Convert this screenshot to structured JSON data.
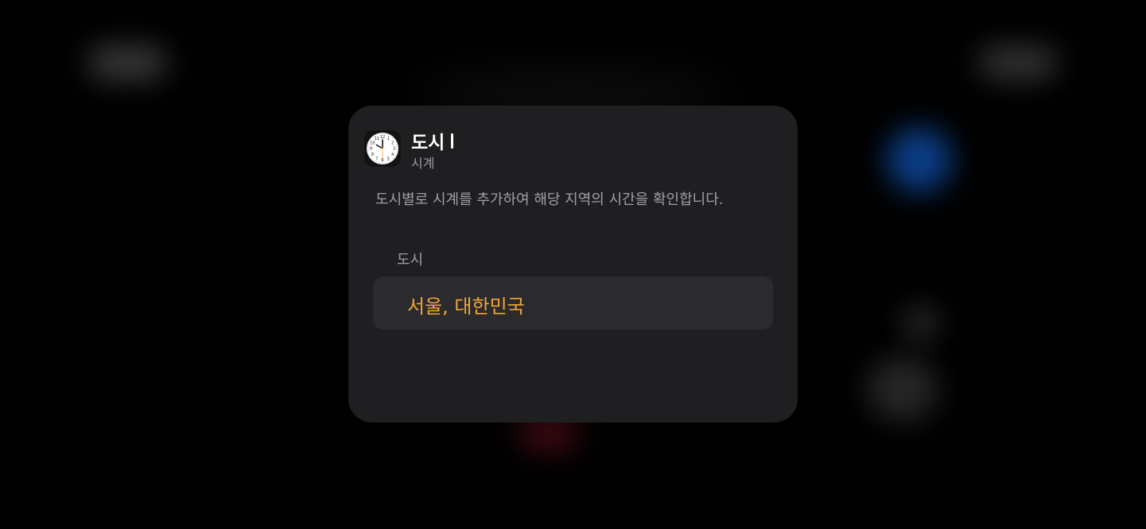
{
  "card": {
    "title": "도시",
    "app_name": "시계",
    "app_icon": "clock-icon",
    "description": "도시별로 시계를 추가하여 해당 지역의 시간을 확인합니다.",
    "parameter_label": "도시",
    "parameter_value": "서울, 대한민국"
  },
  "colors": {
    "background": "#000000",
    "card_background": "#1f1f21",
    "row_background": "#2b2b2d",
    "accent": "#f0a43a",
    "title_text": "#ffffff",
    "secondary_text": "#a0a0a5"
  },
  "clock_face": {
    "numerals": [
      "12",
      "1",
      "2",
      "3",
      "4",
      "5",
      "6",
      "7",
      "8",
      "9",
      "10",
      "11"
    ]
  }
}
